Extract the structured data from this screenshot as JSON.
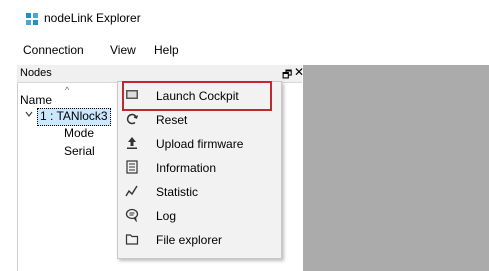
{
  "window": {
    "title": "nodeLink Explorer"
  },
  "menubar": {
    "items": [
      "Connection",
      "View",
      "Help"
    ]
  },
  "dock": {
    "title": "Nodes",
    "float_glyph": "🗗",
    "close_glyph": "✕"
  },
  "tree": {
    "column_header": "Name",
    "root": {
      "label": "1 : TANlock3"
    },
    "children": [
      "Mode",
      "Serial"
    ]
  },
  "context_menu": {
    "items": [
      {
        "label": "Launch Cockpit",
        "icon": "monitor-icon"
      },
      {
        "label": "Reset",
        "icon": "refresh-icon"
      },
      {
        "label": "Upload firmware",
        "icon": "upload-icon"
      },
      {
        "label": "Information",
        "icon": "info-list-icon"
      },
      {
        "label": "Statistic",
        "icon": "chart-line-icon"
      },
      {
        "label": "Log",
        "icon": "chat-log-icon"
      },
      {
        "label": "File explorer",
        "icon": "folder-icon"
      }
    ],
    "highlighted_index": 0,
    "highlight_color": "#c0282f"
  },
  "colors": {
    "right_pane": "#ababab",
    "selection": "#cce8ff",
    "brand_icon": "#1c8fd6"
  }
}
